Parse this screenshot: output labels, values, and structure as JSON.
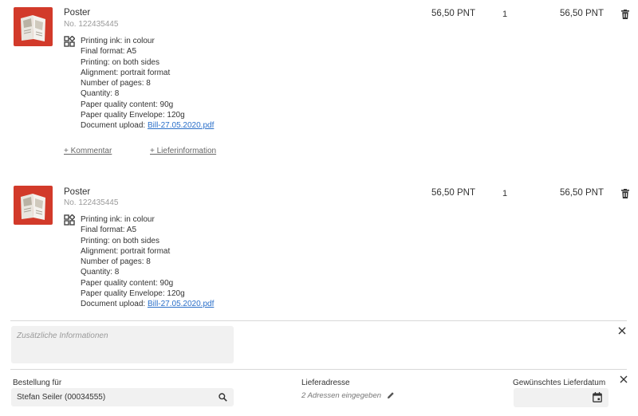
{
  "currency": "PNT",
  "items": [
    {
      "title": "Poster",
      "sku": "No. 122435445",
      "specs": [
        "Printing ink: in colour",
        "Final format: A5",
        "Printing: on both sides",
        "Alignment: portrait format",
        "Number of pages: 8",
        "Quantity: 8",
        "Paper quality content: 90g",
        "Paper quality Envelope: 120g"
      ],
      "upload_label": "Document upload:",
      "upload_file": "Bill-27.05.2020.pdf",
      "unit_price": "56,50 PNT",
      "quantity": "1",
      "total_price": "56,50 PNT",
      "comment_link": "+ Kommentar",
      "delivery_link": "+ Lieferinformation"
    },
    {
      "title": "Poster",
      "sku": "No. 122435445",
      "specs": [
        "Printing ink: in colour",
        "Final format: A5",
        "Printing: on both sides",
        "Alignment: portrait format",
        "Number of pages: 8",
        "Quantity: 8",
        "Paper quality content: 90g",
        "Paper quality Envelope: 120g"
      ],
      "upload_label": "Document upload:",
      "upload_file": "Bill-27.05.2020.pdf",
      "unit_price": "56,50 PNT",
      "quantity": "1",
      "total_price": "56,50 PNT"
    }
  ],
  "additional_info": {
    "placeholder": "Zusätzliche Informationen",
    "value": ""
  },
  "order": {
    "order_for_label": "Bestellung für",
    "order_for_value": "Stefan Seiler (00034555)",
    "address_label": "Lieferadresse",
    "address_value": "2 Adressen eingegeben",
    "date_label": "Gewünschtes Lieferdatum",
    "date_value": ""
  },
  "icons": {
    "thumbnail": "product-thumbnail",
    "config": "product-config-icon",
    "delete": "trash-icon",
    "close": "close-icon",
    "search": "search-icon",
    "edit": "pencil-icon",
    "calendar": "calendar-icon"
  },
  "colors": {
    "thumbnail_bg": "#d23a2a",
    "link": "#2a6fc9",
    "field_bg": "#f1f1f1"
  }
}
